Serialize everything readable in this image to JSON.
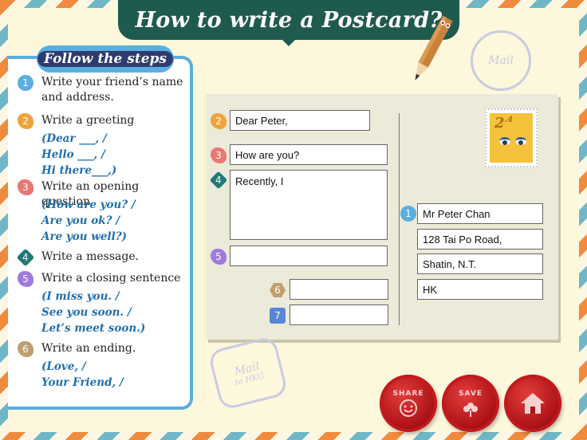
{
  "title": "How to write a Postcard?",
  "steps_heading": "Follow the steps",
  "steps": [
    {
      "num": "1",
      "text": "Write your friend’s name and address.",
      "color": "#5aaee0",
      "examples": []
    },
    {
      "num": "2",
      "text": "Write a greeting",
      "color": "#f0a33a",
      "examples": [
        "(Dear ___, /",
        "Hello ___, /",
        "Hi there___,)"
      ]
    },
    {
      "num": "3",
      "text": "Write an opening question",
      "color": "#e87872",
      "examples": [
        "(How are you? /",
        "Are you ok? /",
        "Are you well?)"
      ]
    },
    {
      "num": "4",
      "text": "Write a message.",
      "color": "#1f7a78",
      "examples": []
    },
    {
      "num": "5",
      "text": "Write a closing sentence",
      "color": "#a07ae0",
      "examples": [
        "(I miss you. /",
        "See you soon. /",
        "Let’s meet soon.)"
      ]
    },
    {
      "num": "6",
      "text": "Write an ending.",
      "color": "#bfa070",
      "examples": [
        "(Love, /",
        "Your Friend, /"
      ]
    }
  ],
  "postcard": {
    "greeting": "Dear Peter,",
    "opening_question": "How are you?",
    "message": "Recently, I",
    "closing_sentence": "",
    "ending": "",
    "signature": "",
    "address_lines": [
      "Mr Peter Chan",
      "128 Tai Po Road,",
      "Shatin, N.T.",
      "HK"
    ],
    "badge_7": "7",
    "badge_7_color": "#5a86d6"
  },
  "stamp": {
    "value": "2",
    "decimal": ".4"
  },
  "postmarks": {
    "top": "Mail",
    "bottom": "Mail",
    "bottom_sub": "to HKG"
  },
  "buttons": {
    "share": "SHARE",
    "save": "SAVE",
    "home_icon": "home-icon"
  }
}
